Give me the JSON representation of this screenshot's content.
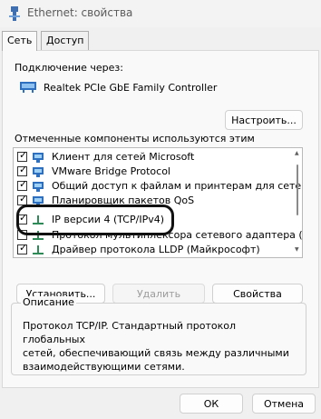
{
  "window": {
    "title": "Ethernet: свойства"
  },
  "tabs": [
    {
      "label": "Сеть",
      "active": true
    },
    {
      "label": "Доступ",
      "active": false
    }
  ],
  "connection": {
    "label": "Подключение через:",
    "adapter": "Realtek PCIe GbE Family Controller",
    "configure_button": "Настроить..."
  },
  "components": {
    "label": "Отмеченные компоненты используются этим подключением:",
    "items": [
      {
        "label": "Клиент для сетей Microsoft",
        "checked": true,
        "icon": "network-client-icon"
      },
      {
        "label": "VMware Bridge Protocol",
        "checked": true,
        "icon": "network-service-icon"
      },
      {
        "label": "Общий доступ к файлам и принтерам для сетей Mi",
        "checked": true,
        "icon": "network-service-icon"
      },
      {
        "label": "Планировщик пакетов QoS",
        "checked": true,
        "icon": "network-service-icon"
      },
      {
        "label": "IP версии 4 (TCP/IPv4)",
        "checked": true,
        "icon": "protocol-icon"
      },
      {
        "label": "Протокол мультиплексора сетевого адаптера (Май",
        "checked": false,
        "icon": "protocol-icon"
      },
      {
        "label": "Драйвер протокола LLDP (Майкрософт)",
        "checked": true,
        "icon": "protocol-icon"
      }
    ]
  },
  "buttons": {
    "install": "Установить...",
    "remove": "Удалить",
    "properties": "Свойства",
    "ok": "ОК",
    "cancel": "Отмена"
  },
  "description": {
    "title": "Описание",
    "lines": [
      "Протокол TCP/IP. Стандартный протокол глобальных",
      "сетей, обеспечивающий связь между различными",
      "взаимодействующими сетями."
    ]
  },
  "colors": {
    "highlight_border": "#111111",
    "protocol_icon": "#2e8b57",
    "service_icon": "#2f6fbf"
  }
}
